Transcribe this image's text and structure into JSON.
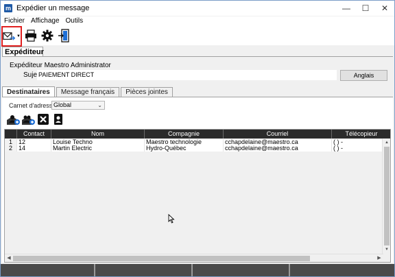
{
  "window": {
    "title": "Expédier un message",
    "app_icon_letter": "m",
    "controls": [
      "—",
      "☐",
      "✕"
    ]
  },
  "menu": {
    "items": [
      "Fichier",
      "Affichage",
      "Outils"
    ]
  },
  "toolbar": {
    "buttons": [
      {
        "name": "send-icon",
        "tooltip": ""
      },
      {
        "name": "print-icon"
      },
      {
        "name": "gear-icon"
      },
      {
        "name": "exit-door-icon"
      }
    ]
  },
  "sender_tab": {
    "label": "Expéditeur",
    "sender_line": "Expéditeur Maestro Administrator",
    "subject_label": "Sujet",
    "subject_value": "PAIEMENT DIRECT",
    "language_button": "Anglais"
  },
  "tabs": [
    {
      "label": "Destinataires",
      "active": true
    },
    {
      "label": "Message français",
      "active": false
    },
    {
      "label": "Pièces jointes",
      "active": false
    }
  ],
  "address_book": {
    "label": "Carnet d'adresses",
    "selected": "Global"
  },
  "recipient_toolbar": [
    "add-contact-icon",
    "add-group-icon",
    "delete-icon",
    "contact-card-icon"
  ],
  "grid": {
    "columns": [
      "",
      "Contact",
      "Nom",
      "Compagnie",
      "Courriel",
      "Télécopieur"
    ],
    "rows": [
      [
        "1",
        "12",
        "Louise Techno",
        "Maestro technologie",
        "cchapdelaine@maestro.ca",
        "(   )  -"
      ],
      [
        "2",
        "14",
        "Martin Électric",
        "Hydro-Québec",
        "cchapdelaine@maestro.ca",
        "(   )  -"
      ]
    ]
  },
  "colors": {
    "highlight_border": "#e02020",
    "grid_header": "#2b2b2b",
    "status_bar": "#4a4a4a"
  }
}
